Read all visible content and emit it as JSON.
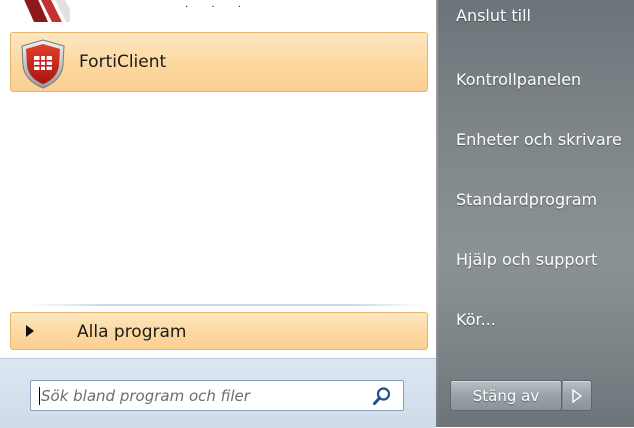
{
  "left_panel": {
    "pinned": [
      {
        "label": "FortiClient",
        "icon": "forticlient-shield-icon"
      }
    ],
    "all_programs_label": "Alla program",
    "search": {
      "placeholder": "Sök bland program och filer",
      "icon": "magnifier-icon"
    }
  },
  "right_panel": {
    "items": [
      {
        "label": "Anslut till"
      },
      {
        "label": "Kontrollpanelen"
      },
      {
        "label": "Enheter och skrivare"
      },
      {
        "label": "Standardprogram"
      },
      {
        "label": "Hjälp och support"
      },
      {
        "label": "Kör..."
      }
    ],
    "shutdown_label": "Stäng av"
  },
  "colors": {
    "highlight": "#fcd8a0",
    "highlight_border": "#e7b46c",
    "right_panel": "#7d8589",
    "forticlient_red": "#c8201e"
  }
}
